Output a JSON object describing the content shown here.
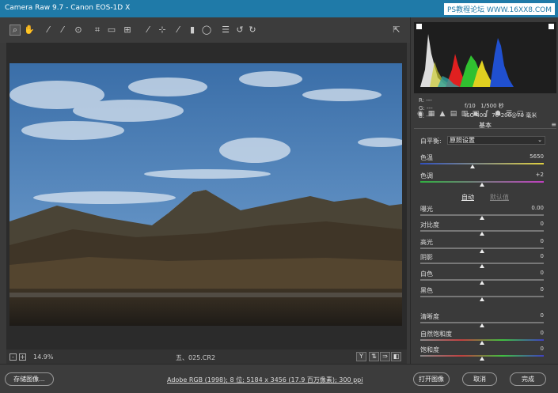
{
  "window": {
    "title": "Camera Raw 9.7 -  Canon EOS-1D X"
  },
  "watermark": "PS教程论坛 WWW.16XX8.COM",
  "toolbar": {
    "tools": [
      "zoom-icon",
      "hand-icon",
      "white-balance-icon",
      "color-sampler-icon",
      "targeted-adjustment-icon",
      "crop-icon",
      "straighten-icon",
      "transform-icon",
      "spot-removal-icon",
      "red-eye-icon",
      "adjustment-brush-icon",
      "graduated-filter-icon",
      "radial-filter-icon",
      "preferences-icon",
      "rotate-ccw-icon",
      "rotate-cw-icon"
    ]
  },
  "histogram": {
    "r_label": "R:",
    "g_label": "G:",
    "b_label": "B:",
    "r_value": "---",
    "g_value": "---",
    "b_value": "---"
  },
  "exif": {
    "line1": "f/10   1/500 秒",
    "line2": "ISO 400   70-200@70 毫米"
  },
  "panel": {
    "title": "基本",
    "menu": "≡"
  },
  "white_balance": {
    "label": "白平衡:",
    "value": "原照设置"
  },
  "sliders": [
    {
      "label": "色温",
      "value": "5650",
      "pos": 0.42
    },
    {
      "label": "色调",
      "value": "+2",
      "pos": 0.5
    },
    {
      "label": "曝光",
      "value": "0.00",
      "pos": 0.5
    },
    {
      "label": "对比度",
      "value": "0",
      "pos": 0.5
    },
    {
      "label": "高光",
      "value": "0",
      "pos": 0.5
    },
    {
      "label": "阴影",
      "value": "0",
      "pos": 0.5
    },
    {
      "label": "白色",
      "value": "0",
      "pos": 0.5
    },
    {
      "label": "黑色",
      "value": "0",
      "pos": 0.5
    },
    {
      "label": "清晰度",
      "value": "0",
      "pos": 0.5
    },
    {
      "label": "自然饱和度",
      "value": "0",
      "pos": 0.5
    },
    {
      "label": "饱和度",
      "value": "0",
      "pos": 0.5
    }
  ],
  "auto_label": "自动",
  "default_label": "默认值",
  "status": {
    "zoom_minus": "-",
    "zoom_plus": "+",
    "zoom": "14.9%",
    "filename": "五、025.CR2",
    "view_y": "Y"
  },
  "buttons": {
    "save": "存储图像...",
    "open": "打开图像",
    "cancel": "取消",
    "done": "完成"
  },
  "workflow": "Adobe RGB (1998); 8 位; 5184 x 3456 (17.9 百万像素); 300 ppi",
  "colors": {
    "titlebar": "#1f7aa8"
  }
}
